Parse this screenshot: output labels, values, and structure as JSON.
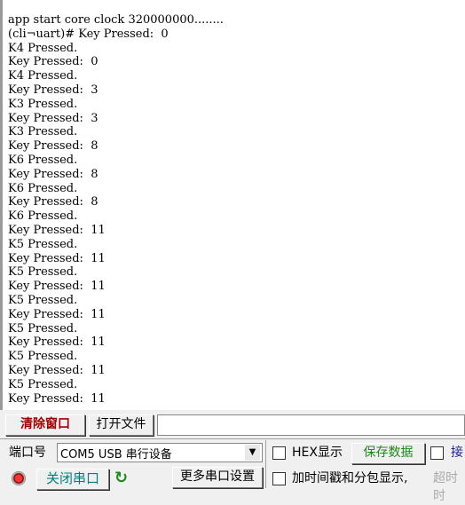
{
  "terminal": {
    "lines": [
      "app start core clock 320000000........",
      "(cli¬uart)# Key Pressed:  0",
      "K4 Pressed.",
      "Key Pressed:  0",
      "K4 Pressed.",
      "Key Pressed:  3",
      "K3 Pressed.",
      "Key Pressed:  3",
      "K3 Pressed.",
      "Key Pressed:  8",
      "K6 Pressed.",
      "Key Pressed:  8",
      "K6 Pressed.",
      "Key Pressed:  8",
      "K6 Pressed.",
      "Key Pressed:  11",
      "K5 Pressed.",
      "Key Pressed:  11",
      "K5 Pressed.",
      "Key Pressed:  11",
      "K5 Pressed.",
      "Key Pressed:  11",
      "K5 Pressed.",
      "Key Pressed:  11",
      "K5 Pressed.",
      "Key Pressed:  11",
      "K5 Pressed.",
      "Key Pressed:  11"
    ]
  },
  "toolbar": {
    "clear": "清除窗口",
    "open_file": "打开文件",
    "file_path": ""
  },
  "port": {
    "label": "端口号",
    "selected": "COM5 USB 串行设备",
    "hex_display": "HEX显示",
    "save_data": "保存数据",
    "recv_partial": "接",
    "close_port": "关闭串口",
    "more_settings": "更多串口设置",
    "timestamp": "加时间戳和分包显示,",
    "timeout_partial": "超时时"
  },
  "colors": {
    "clear": "#a00000",
    "close_port": "#008080",
    "save_data": "#1a8a1a",
    "recv": "#1a1aa0"
  }
}
